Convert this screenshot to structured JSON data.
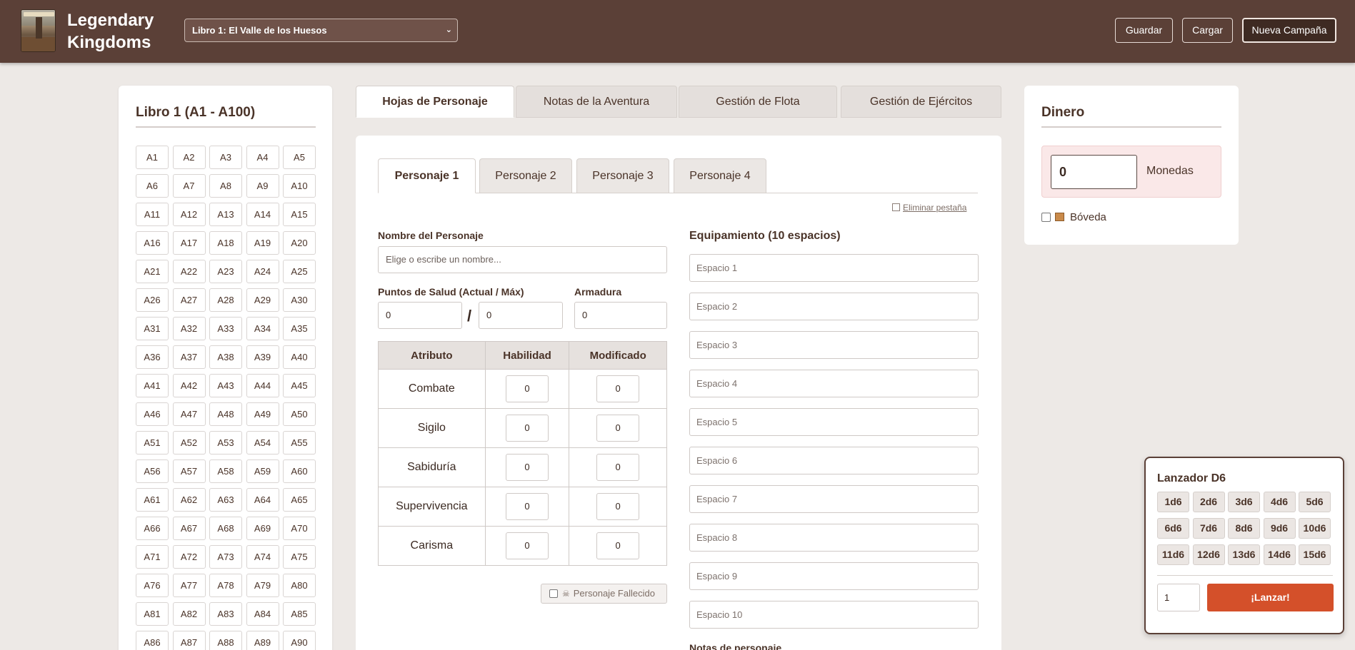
{
  "header": {
    "app_title": "Legendary Kingdoms",
    "book_select": "Libro 1: El Valle de los Huesos",
    "buttons": {
      "save": "Guardar",
      "load": "Cargar",
      "new_campaign": "Nueva Campaña"
    }
  },
  "sections_panel": {
    "title": "Libro 1 (A1 - A100)",
    "sections": [
      "A1",
      "A2",
      "A3",
      "A4",
      "A5",
      "A6",
      "A7",
      "A8",
      "A9",
      "A10",
      "A11",
      "A12",
      "A13",
      "A14",
      "A15",
      "A16",
      "A17",
      "A18",
      "A19",
      "A20",
      "A21",
      "A22",
      "A23",
      "A24",
      "A25",
      "A26",
      "A27",
      "A28",
      "A29",
      "A30",
      "A31",
      "A32",
      "A33",
      "A34",
      "A35",
      "A36",
      "A37",
      "A38",
      "A39",
      "A40",
      "A41",
      "A42",
      "A43",
      "A44",
      "A45",
      "A46",
      "A47",
      "A48",
      "A49",
      "A50",
      "A51",
      "A52",
      "A53",
      "A54",
      "A55",
      "A56",
      "A57",
      "A58",
      "A59",
      "A60",
      "A61",
      "A62",
      "A63",
      "A64",
      "A65",
      "A66",
      "A67",
      "A68",
      "A69",
      "A70",
      "A71",
      "A72",
      "A73",
      "A74",
      "A75",
      "A76",
      "A77",
      "A78",
      "A79",
      "A80",
      "A81",
      "A82",
      "A83",
      "A84",
      "A85",
      "A86",
      "A87",
      "A88",
      "A89",
      "A90"
    ]
  },
  "main_tabs": [
    "Hojas de Personaje",
    "Notas de la Aventura",
    "Gestión de Flota",
    "Gestión de Ejércitos"
  ],
  "character": {
    "tabs": [
      "Personaje 1",
      "Personaje 2",
      "Personaje 3",
      "Personaje 4"
    ],
    "delete_tab": "Eliminar pestaña",
    "name_label": "Nombre del Personaje",
    "name_placeholder": "Elige o escribe un nombre...",
    "health_label": "Puntos de Salud (Actual / Máx)",
    "health_current": "0",
    "health_max": "0",
    "armor_label": "Armadura",
    "armor_value": "0",
    "attr_headers": [
      "Atributo",
      "Habilidad",
      "Modificado"
    ],
    "attributes": [
      {
        "name": "Combate",
        "skill": "0",
        "modified": "0"
      },
      {
        "name": "Sigilo",
        "skill": "0",
        "modified": "0"
      },
      {
        "name": "Sabiduría",
        "skill": "0",
        "modified": "0"
      },
      {
        "name": "Supervivencia",
        "skill": "0",
        "modified": "0"
      },
      {
        "name": "Carisma",
        "skill": "0",
        "modified": "0"
      }
    ],
    "dead_label": "Personaje Fallecido",
    "equipment_title": "Equipamiento (10 espacios)",
    "slots": [
      "Espacio 1",
      "Espacio 2",
      "Espacio 3",
      "Espacio 4",
      "Espacio 5",
      "Espacio 6",
      "Espacio 7",
      "Espacio 8",
      "Espacio 9",
      "Espacio 10"
    ],
    "notes_label": "Notas de personaje"
  },
  "money": {
    "title": "Dinero",
    "value": "0",
    "unit": "Monedas",
    "vault_label": "Bóveda"
  },
  "dice": {
    "title": "Lanzador D6",
    "options": [
      "1d6",
      "2d6",
      "3d6",
      "4d6",
      "5d6",
      "6d6",
      "7d6",
      "8d6",
      "9d6",
      "10d6",
      "11d6",
      "12d6",
      "13d6",
      "14d6",
      "15d6"
    ],
    "quantity": "1",
    "roll_label": "¡Lanzar!"
  },
  "colors": {
    "header": "#5b4037",
    "accent": "#d4502a",
    "money_bg": "#fae8e8"
  }
}
